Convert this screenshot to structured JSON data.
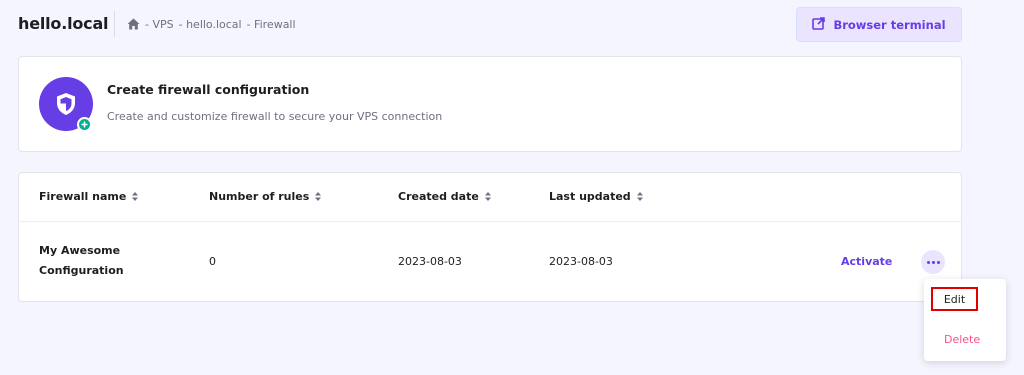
{
  "header": {
    "site_title": "hello.local",
    "breadcrumb": [
      "- VPS",
      "- hello.local",
      "- Firewall"
    ],
    "terminal_button": "Browser terminal"
  },
  "create_card": {
    "title": "Create firewall configuration",
    "description": "Create and customize firewall to secure your VPS connection"
  },
  "table": {
    "headers": [
      "Firewall name",
      "Number of rules",
      "Created date",
      "Last updated"
    ],
    "rows": [
      {
        "name_line1": "My Awesome",
        "name_line2": "Configuration",
        "rules": "0",
        "created": "2023-08-03",
        "updated": "2023-08-03",
        "action": "Activate"
      }
    ]
  },
  "dropdown": {
    "items": [
      "Edit",
      "Delete"
    ]
  },
  "colors": {
    "accent": "#673de6",
    "accent_light": "#ebe4ff",
    "success": "#00b090",
    "danger": "#fc5185",
    "highlight": "#e00000"
  }
}
